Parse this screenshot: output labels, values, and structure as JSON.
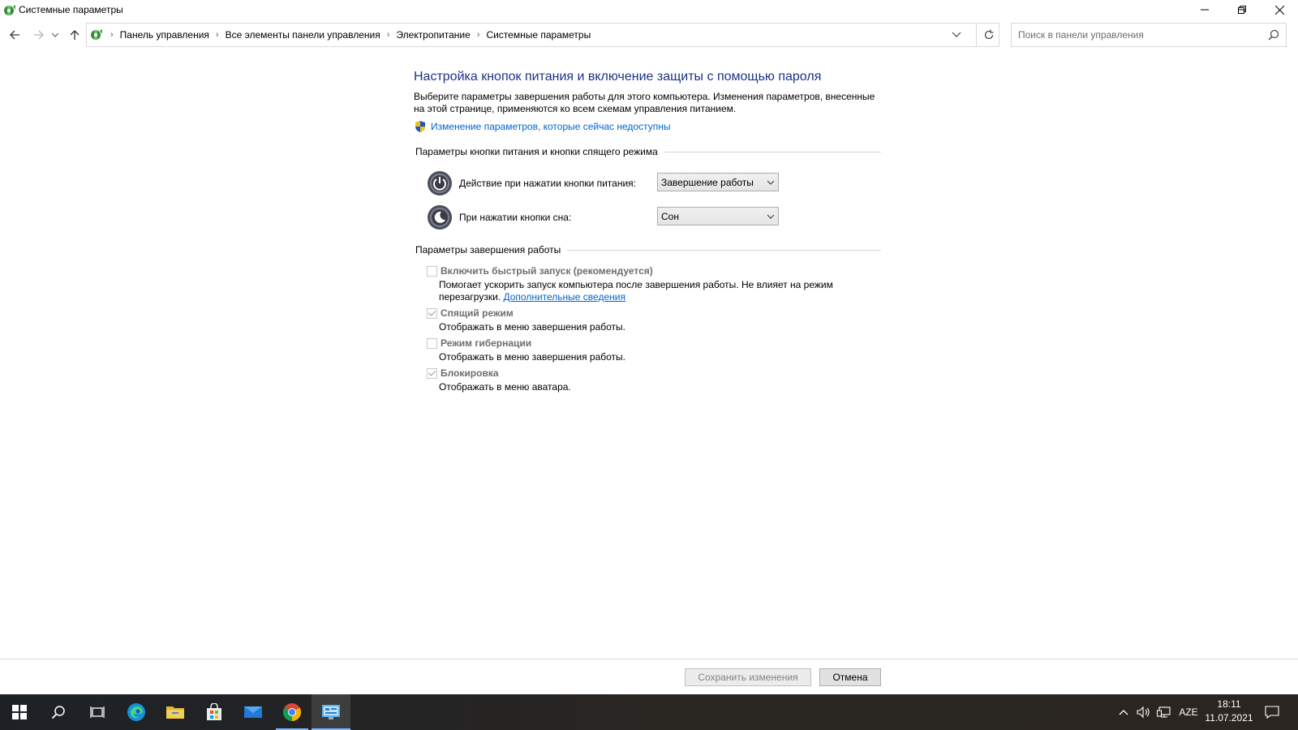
{
  "window": {
    "title": "Системные параметры",
    "controls": {
      "minimize": "minimize",
      "maximize": "restore",
      "close": "close"
    }
  },
  "breadcrumbs": [
    "Панель управления",
    "Все элементы панели управления",
    "Электропитание",
    "Системные параметры"
  ],
  "search": {
    "placeholder": "Поиск в панели управления",
    "value": ""
  },
  "page": {
    "heading": "Настройка кнопок питания и включение защиты с помощью пароля",
    "description": "Выберите параметры завершения работы для этого компьютера. Изменения параметров, внесенные на этой странице, применяются ко всем схемам управления питанием.",
    "admin_link": "Изменение параметров, которые сейчас недоступны"
  },
  "power_buttons": {
    "group_title": "Параметры кнопки питания и кнопки спящего режима",
    "power_label": "Действие при нажатии кнопки питания:",
    "power_value": "Завершение работы",
    "sleep_label": "При нажатии кнопки сна:",
    "sleep_value": "Сон"
  },
  "shutdown": {
    "group_title": "Параметры завершения работы",
    "items": [
      {
        "label": "Включить быстрый запуск (рекомендуется)",
        "checked": false,
        "desc": "Помогает ускорить запуск компьютера после завершения работы. Не влияет на режим перезагрузки.",
        "link": "Дополнительные сведения"
      },
      {
        "label": "Спящий режим",
        "checked": true,
        "desc": "Отображать в меню завершения работы."
      },
      {
        "label": "Режим гибернации",
        "checked": false,
        "desc": "Отображать в меню завершения работы."
      },
      {
        "label": "Блокировка",
        "checked": true,
        "desc": "Отображать в меню аватара."
      }
    ]
  },
  "footer": {
    "save": "Сохранить изменения",
    "cancel": "Отмена"
  },
  "taskbar": {
    "apps": [
      "start-icon",
      "search-icon",
      "task-view-icon",
      "edge-icon",
      "file-explorer-icon",
      "store-icon",
      "mail-icon",
      "chrome-icon",
      "control-panel-icon"
    ],
    "language": "AZE",
    "time": "18:11",
    "date": "11.07.2021"
  },
  "colors": {
    "heading": "#1e3287",
    "link": "#0066cc",
    "taskbar": "#1d2126",
    "accent": "#7eb6ff"
  }
}
